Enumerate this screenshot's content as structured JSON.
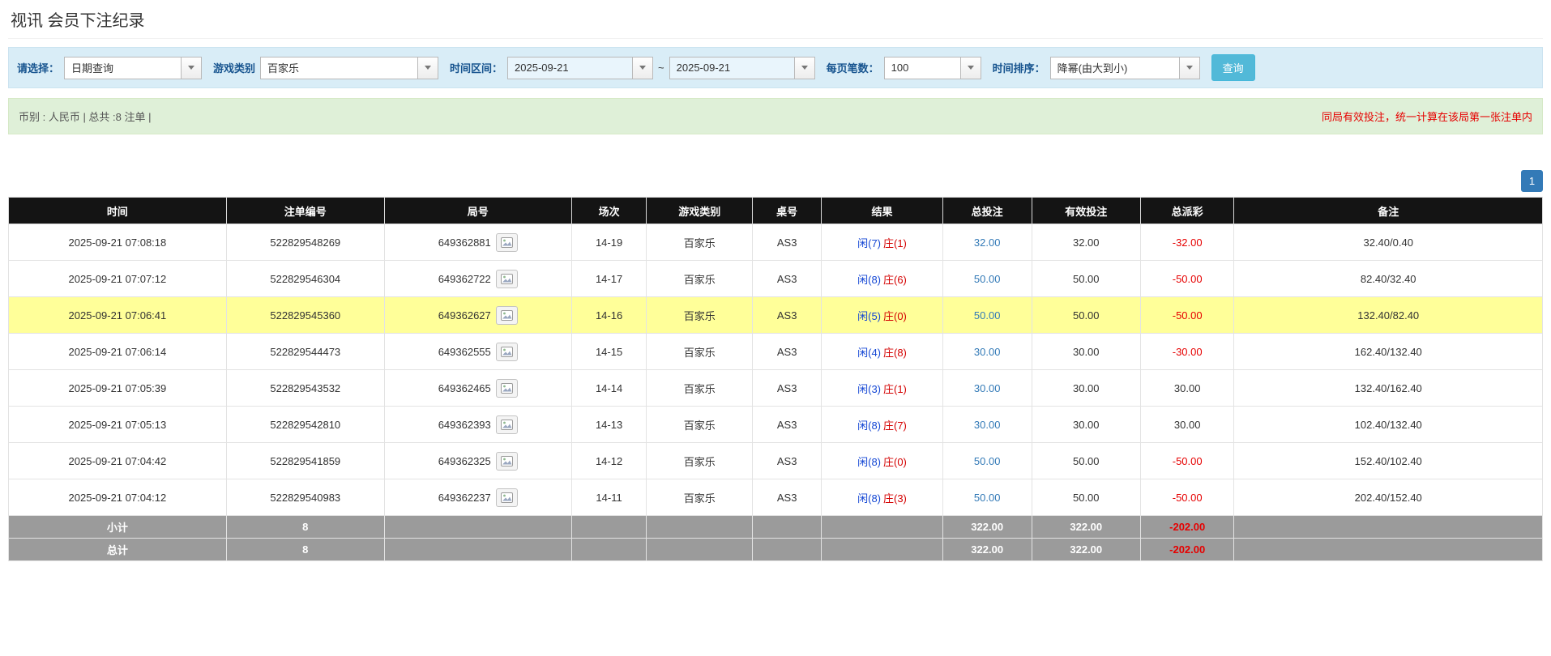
{
  "page_title": "视讯 会员下注纪录",
  "colors": {
    "filter_bar_bg": "#d9edf7",
    "summary_bar_bg": "#dff0d8",
    "highlight_row": "#ffff99",
    "table_header_bg": "#141414",
    "footer_row_bg": "#9b9b9b",
    "accent_blue": "#337ab7",
    "search_button_blue": "#52b9d8",
    "negative_red": "#e60000",
    "player_blue": "#1346d4",
    "banker_red": "#d40000"
  },
  "filters": {
    "query_type_label": "请选择：",
    "query_type_value": "日期查询",
    "game_type_label": "游戏类别",
    "game_type_value": "百家乐",
    "date_range_label": "时间区间：",
    "date_from": "2025-09-21",
    "range_separator": "~",
    "date_to": "2025-09-21",
    "page_size_label": "每页笔数：",
    "page_size_value": "100",
    "sort_label": "时间排序：",
    "sort_value": "降幂(由大到小)",
    "search_button": "查询"
  },
  "summary": {
    "left": "币别 : 人民币 | 总共 :8 注单 |",
    "right": "同局有效投注，统一计算在该局第一张注单内"
  },
  "pagination": {
    "current": "1"
  },
  "table": {
    "headers": [
      "时间",
      "注单编号",
      "局号",
      "场次",
      "游戏类别",
      "桌号",
      "结果",
      "总投注",
      "有效投注",
      "总派彩",
      "备注"
    ],
    "rows": [
      {
        "time": "2025-09-21 07:08:18",
        "bet_id": "522829548269",
        "round_id": "649362881",
        "session": "14-19",
        "game": "百家乐",
        "table_no": "AS3",
        "result_player": "闲(7)",
        "result_banker": "庄(1)",
        "total_bet": "32.00",
        "valid_bet": "32.00",
        "payout": "-32.00",
        "remark": "32.40/0.40",
        "highlight": false
      },
      {
        "time": "2025-09-21 07:07:12",
        "bet_id": "522829546304",
        "round_id": "649362722",
        "session": "14-17",
        "game": "百家乐",
        "table_no": "AS3",
        "result_player": "闲(8)",
        "result_banker": "庄(6)",
        "total_bet": "50.00",
        "valid_bet": "50.00",
        "payout": "-50.00",
        "remark": "82.40/32.40",
        "highlight": false
      },
      {
        "time": "2025-09-21 07:06:41",
        "bet_id": "522829545360",
        "round_id": "649362627",
        "session": "14-16",
        "game": "百家乐",
        "table_no": "AS3",
        "result_player": "闲(5)",
        "result_banker": "庄(0)",
        "total_bet": "50.00",
        "valid_bet": "50.00",
        "payout": "-50.00",
        "remark": "132.40/82.40",
        "highlight": true
      },
      {
        "time": "2025-09-21 07:06:14",
        "bet_id": "522829544473",
        "round_id": "649362555",
        "session": "14-15",
        "game": "百家乐",
        "table_no": "AS3",
        "result_player": "闲(4)",
        "result_banker": "庄(8)",
        "total_bet": "30.00",
        "valid_bet": "30.00",
        "payout": "-30.00",
        "remark": "162.40/132.40",
        "highlight": false
      },
      {
        "time": "2025-09-21 07:05:39",
        "bet_id": "522829543532",
        "round_id": "649362465",
        "session": "14-14",
        "game": "百家乐",
        "table_no": "AS3",
        "result_player": "闲(3)",
        "result_banker": "庄(1)",
        "total_bet": "30.00",
        "valid_bet": "30.00",
        "payout": "30.00",
        "remark": "132.40/162.40",
        "highlight": false
      },
      {
        "time": "2025-09-21 07:05:13",
        "bet_id": "522829542810",
        "round_id": "649362393",
        "session": "14-13",
        "game": "百家乐",
        "table_no": "AS3",
        "result_player": "闲(8)",
        "result_banker": "庄(7)",
        "total_bet": "30.00",
        "valid_bet": "30.00",
        "payout": "30.00",
        "remark": "102.40/132.40",
        "highlight": false
      },
      {
        "time": "2025-09-21 07:04:42",
        "bet_id": "522829541859",
        "round_id": "649362325",
        "session": "14-12",
        "game": "百家乐",
        "table_no": "AS3",
        "result_player": "闲(8)",
        "result_banker": "庄(0)",
        "total_bet": "50.00",
        "valid_bet": "50.00",
        "payout": "-50.00",
        "remark": "152.40/102.40",
        "highlight": false
      },
      {
        "time": "2025-09-21 07:04:12",
        "bet_id": "522829540983",
        "round_id": "649362237",
        "session": "14-11",
        "game": "百家乐",
        "table_no": "AS3",
        "result_player": "闲(8)",
        "result_banker": "庄(3)",
        "total_bet": "50.00",
        "valid_bet": "50.00",
        "payout": "-50.00",
        "remark": "202.40/152.40",
        "highlight": false
      }
    ],
    "subtotal": {
      "label": "小计",
      "count": "8",
      "total_bet": "322.00",
      "valid_bet": "322.00",
      "payout": "-202.00"
    },
    "total": {
      "label": "总计",
      "count": "8",
      "total_bet": "322.00",
      "valid_bet": "322.00",
      "payout": "-202.00"
    }
  }
}
